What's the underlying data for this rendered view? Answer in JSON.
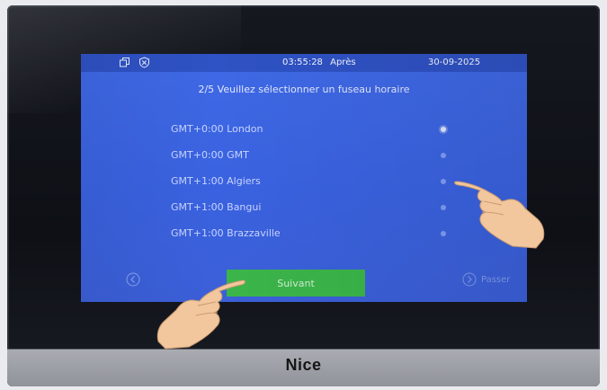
{
  "brand": "Nice",
  "status": {
    "time": "03:55:28",
    "period": "Après",
    "date": "30-09-2025",
    "icons": [
      "window-icon",
      "shield-icon"
    ]
  },
  "setup": {
    "title": "2/5 Veuillez sélectionner un fuseau horaire",
    "timezones": [
      {
        "label": "GMT+0:00 London",
        "selected": true
      },
      {
        "label": "GMT+0:00 GMT",
        "selected": false
      },
      {
        "label": "GMT+1:00 Algiers",
        "selected": false
      },
      {
        "label": "GMT+1:00 Bangui",
        "selected": false
      },
      {
        "label": "GMT+1:00 Brazzaville",
        "selected": false
      }
    ],
    "next_label": "Suivant",
    "skip_label": "Passer"
  },
  "colors": {
    "screen_blue": "#3f69e6",
    "status_bar": "#2f52c4",
    "next_green": "#3bb54a",
    "bezel": "#15181f"
  }
}
